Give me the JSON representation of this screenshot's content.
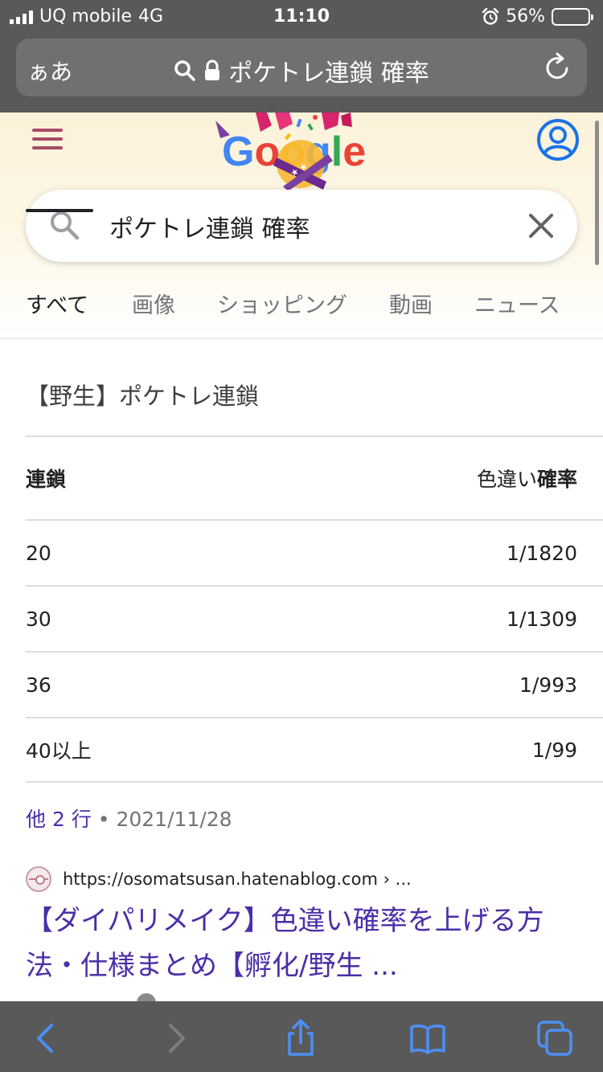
{
  "status_bar": {
    "carrier": "UQ mobile",
    "network": "4G",
    "time": "11:10",
    "battery_percent": "56%",
    "battery_level": 0.56
  },
  "browser": {
    "text_size_label": "ぁあ",
    "url_text": "ポケトレ連鎖 確率"
  },
  "google": {
    "doodle_text": "Google",
    "query": "ポケトレ連鎖 確率",
    "tabs": [
      {
        "label": "すべて",
        "active": true
      },
      {
        "label": "画像"
      },
      {
        "label": "ショッピング"
      },
      {
        "label": "動画"
      },
      {
        "label": "ニュース"
      }
    ]
  },
  "snippet": {
    "title": "【野生】ポケトレ連鎖",
    "columns": [
      "連鎖",
      "色違い",
      "確率"
    ],
    "rows": [
      {
        "chain": "20",
        "rate": "1/1820"
      },
      {
        "chain": "30",
        "rate": "1/1309"
      },
      {
        "chain": "36",
        "rate": "1/993"
      },
      {
        "chain": "40以上",
        "rate": "1/99"
      }
    ],
    "more_rows": "他 2 行",
    "separator": "•",
    "date": "2021/11/28"
  },
  "result": {
    "url": "https://osomatsusan.hatenablog.com › ...",
    "title": "【ダイパリメイク】色違い確率を上げる方法・仕様まとめ【孵化/野生 ..."
  },
  "colors": {
    "chrome_gray": "#595959",
    "link_purple": "#4b2ea8",
    "accent_blue": "#4285f4",
    "hamburger": "#a84b67"
  },
  "icons": [
    "signal-icon",
    "alarm-icon",
    "battery-icon",
    "search-icon",
    "lock-icon",
    "reload-icon",
    "menu-icon",
    "account-icon",
    "close-icon",
    "favicon-icon",
    "back-icon",
    "forward-icon",
    "share-icon",
    "bookmarks-icon",
    "tabs-icon"
  ]
}
